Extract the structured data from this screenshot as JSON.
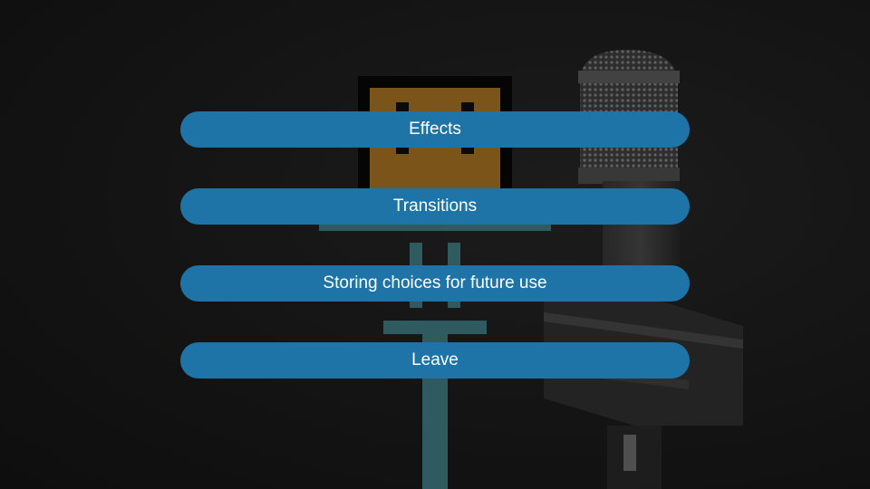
{
  "colors": {
    "background": "#141414",
    "button": "#1e74a6",
    "button_text": "#ffffff",
    "robot_head": "#7a5418",
    "robot_body": "#2f5a60"
  },
  "icons": {
    "robot": "pixel-robot-icon",
    "microphone": "microphone-icon"
  },
  "menu": {
    "items": [
      {
        "label": "Effects"
      },
      {
        "label": "Transitions"
      },
      {
        "label": "Storing choices for future use"
      },
      {
        "label": "Leave"
      }
    ]
  }
}
